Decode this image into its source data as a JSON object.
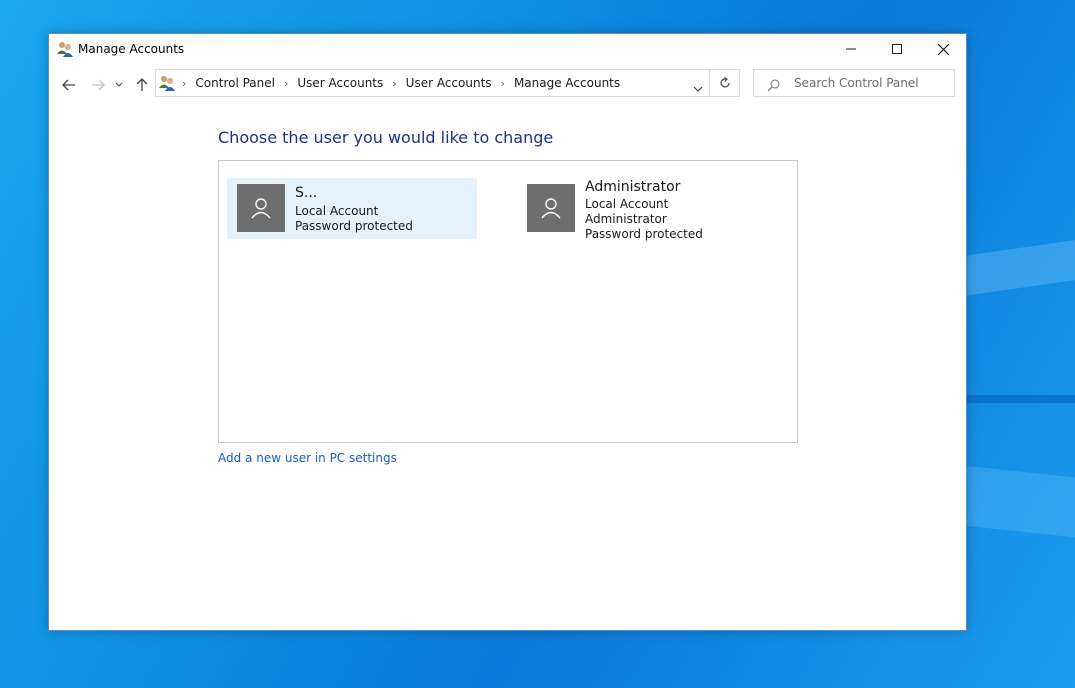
{
  "window": {
    "title": "Manage Accounts",
    "controls": {
      "minimize": "minimize",
      "maximize": "maximize",
      "close": "close"
    }
  },
  "address": {
    "breadcrumbs": [
      "Control Panel",
      "User Accounts",
      "User Accounts",
      "Manage Accounts"
    ]
  },
  "search": {
    "placeholder": "Search Control Panel"
  },
  "main": {
    "heading": "Choose the user you would like to change",
    "accounts": [
      {
        "name": "S...",
        "lines": [
          "Local Account",
          "Password protected"
        ],
        "selected": true
      },
      {
        "name": "Administrator",
        "lines": [
          "Local Account",
          "Administrator",
          "Password protected"
        ],
        "selected": false
      }
    ],
    "add_user_link": "Add a new user in PC settings"
  },
  "colors": {
    "heading": "#1e3287",
    "link": "#1e5bbf",
    "selected_bg": "#e5f1fb",
    "avatar_tile": "#6e6e6e"
  }
}
